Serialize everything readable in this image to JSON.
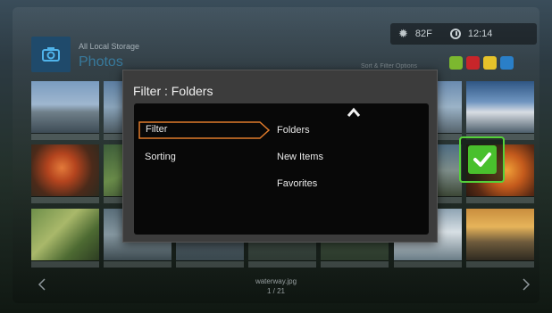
{
  "source": {
    "label": "All Local Storage",
    "title": "Photos"
  },
  "status": {
    "temperature": "82F",
    "time": "12:14"
  },
  "sort_hint": "Sort & Filter Options",
  "color_keys": [
    "#7cb82f",
    "#c8252a",
    "#e6c32a",
    "#2a7fc8"
  ],
  "dialog": {
    "title": "Filter : Folders",
    "menu": [
      {
        "label": "Filter",
        "selected": true
      },
      {
        "label": "Sorting",
        "selected": false
      }
    ],
    "options": [
      "Folders",
      "New Items",
      "Favorites"
    ]
  },
  "footer": {
    "filename": "waterway.jpg",
    "counter": "1 / 21"
  },
  "icons": [
    "camera-icon",
    "sun-icon",
    "clock-icon",
    "chevron-up-icon",
    "checkmark-icon",
    "chevron-left-icon",
    "chevron-right-icon"
  ]
}
